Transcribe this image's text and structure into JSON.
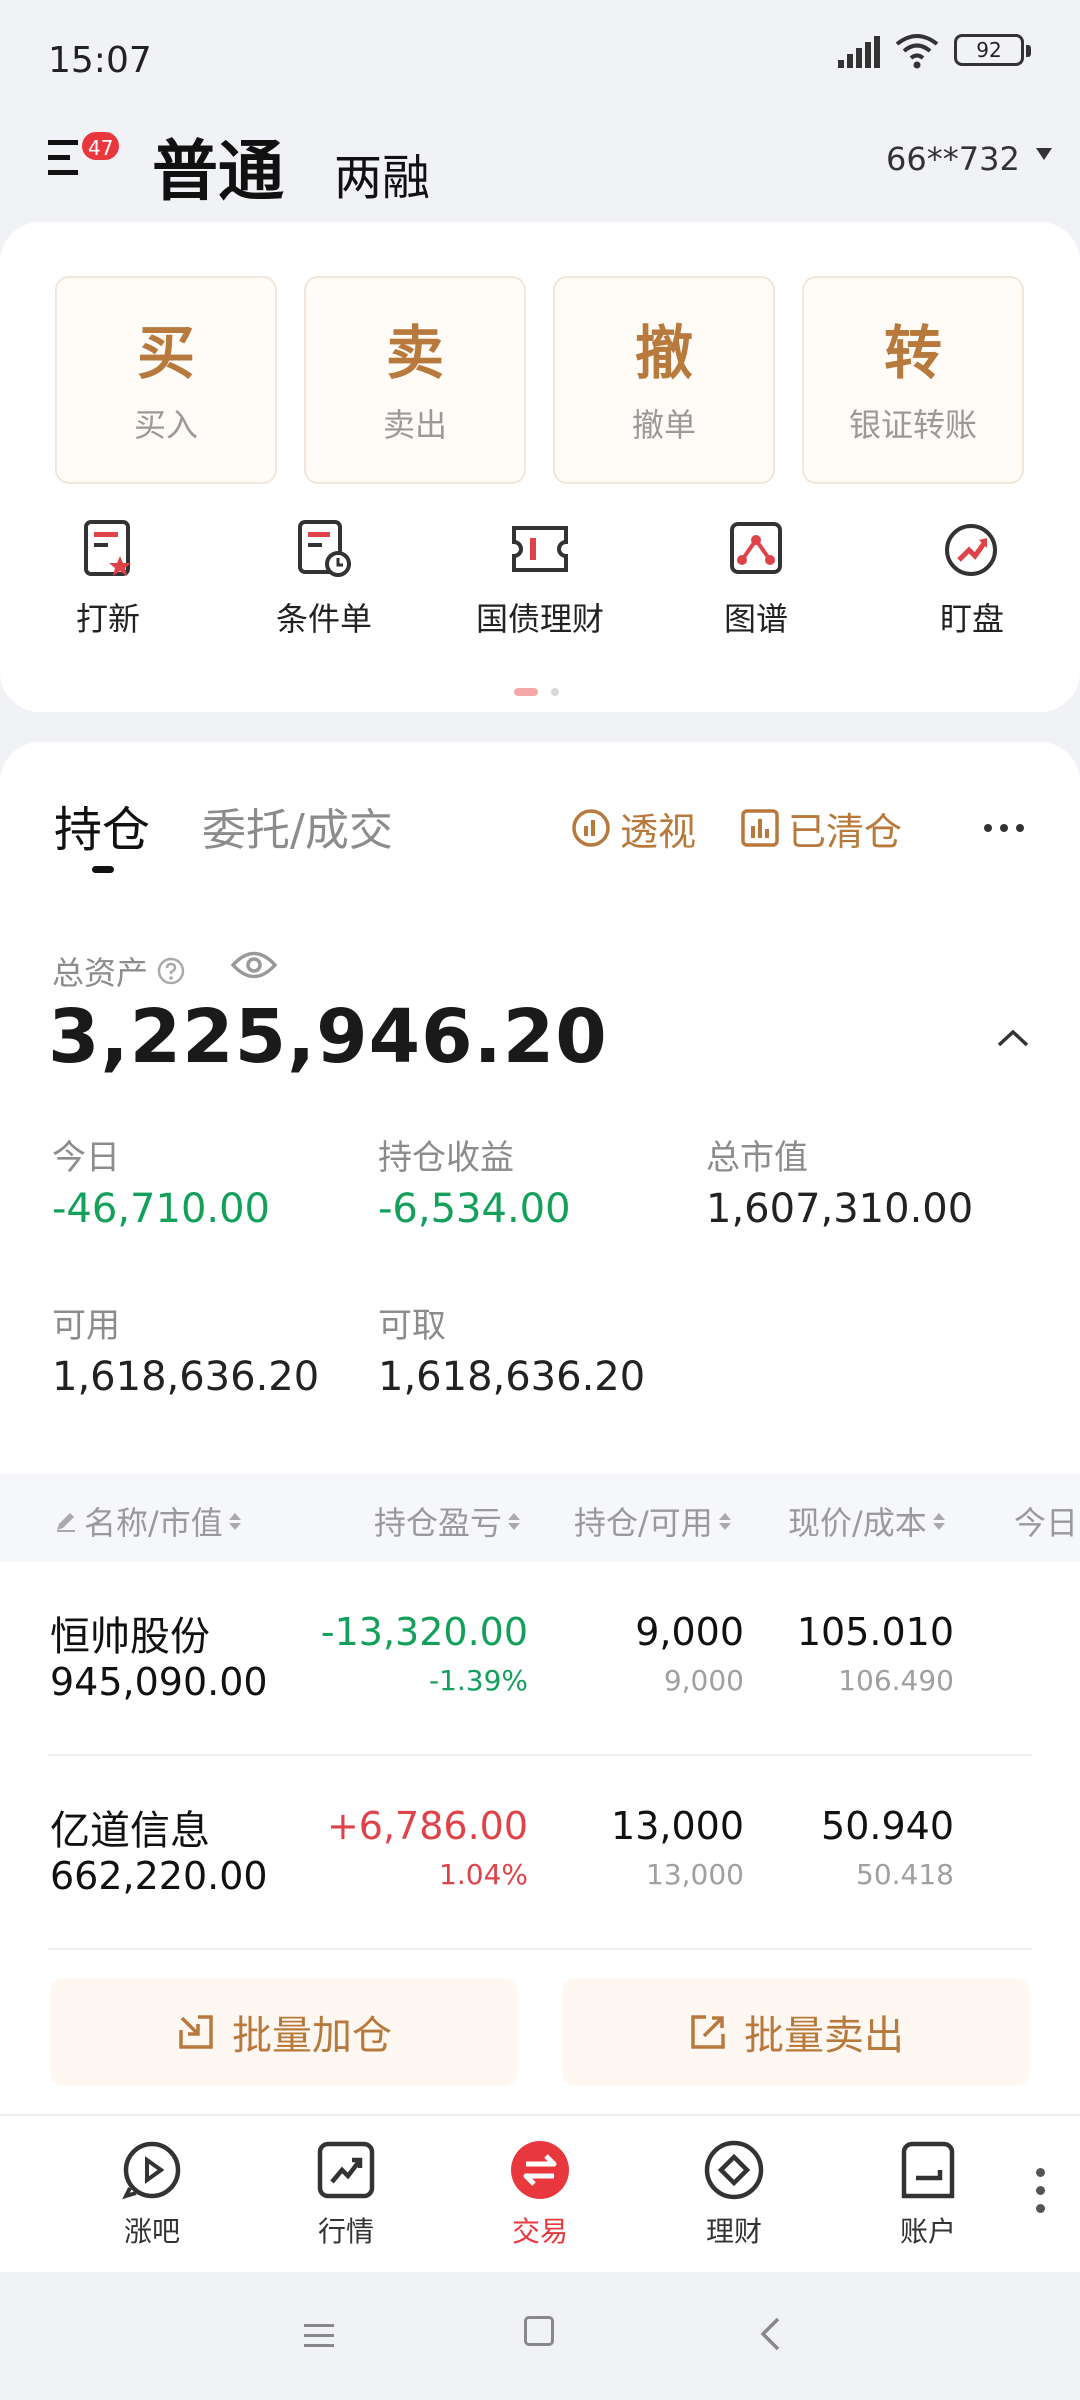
{
  "status_bar": {
    "time": "15:07",
    "battery": "92"
  },
  "header": {
    "menu_badge": "47",
    "account_normal": "普通",
    "account_margin": "两融",
    "account_id": "66**732"
  },
  "trade_buttons": [
    {
      "big": "买",
      "small": "买入"
    },
    {
      "big": "卖",
      "small": "卖出"
    },
    {
      "big": "撤",
      "small": "撤单"
    },
    {
      "big": "转",
      "small": "银证转账"
    }
  ],
  "tools": [
    {
      "label": "打新",
      "icon": "ipo-icon"
    },
    {
      "label": "条件单",
      "icon": "conditional-order-icon"
    },
    {
      "label": "国债理财",
      "icon": "bond-icon"
    },
    {
      "label": "图谱",
      "icon": "graph-icon"
    },
    {
      "label": "盯盘",
      "icon": "watch-icon"
    }
  ],
  "holdings": {
    "tab_positions": "持仓",
    "tab_orders": "委托/成交",
    "perspective": "透视",
    "cleared": "已清仓",
    "total_assets_label": "总资产",
    "total_assets": "3,225,946.20",
    "today_label": "今日",
    "today_value": "-46,710.00",
    "holding_profit_label": "持仓收益",
    "holding_profit_value": "-6,534.00",
    "market_value_label": "总市值",
    "market_value_value": "1,607,310.00",
    "available_label": "可用",
    "available_value": "1,618,636.20",
    "withdrawable_label": "可取",
    "withdrawable_value": "1,618,636.20"
  },
  "table": {
    "headers": [
      "名称/市值",
      "持仓盈亏",
      "持仓/可用",
      "现价/成本",
      "今日"
    ],
    "rows": [
      {
        "name": "恒帅股份",
        "market_value": "945,090.00",
        "pnl": "-13,320.00",
        "pnl_pct": "-1.39%",
        "qty": "9,000",
        "available": "9,000",
        "price": "105.010",
        "cost": "106.490"
      },
      {
        "name": "亿道信息",
        "market_value": "662,220.00",
        "pnl": "+6,786.00",
        "pnl_pct": "1.04%",
        "qty": "13,000",
        "available": "13,000",
        "price": "50.940",
        "cost": "50.418"
      }
    ]
  },
  "batch": {
    "add": "批量加仓",
    "sell": "批量卖出"
  },
  "bottom_nav": [
    {
      "label": "涨吧"
    },
    {
      "label": "行情"
    },
    {
      "label": "交易"
    },
    {
      "label": "理财"
    },
    {
      "label": "账户"
    }
  ],
  "colors": {
    "accent": "#B87A3C",
    "up": "#E0424A",
    "down": "#12A05B",
    "active": "#E8383D"
  }
}
